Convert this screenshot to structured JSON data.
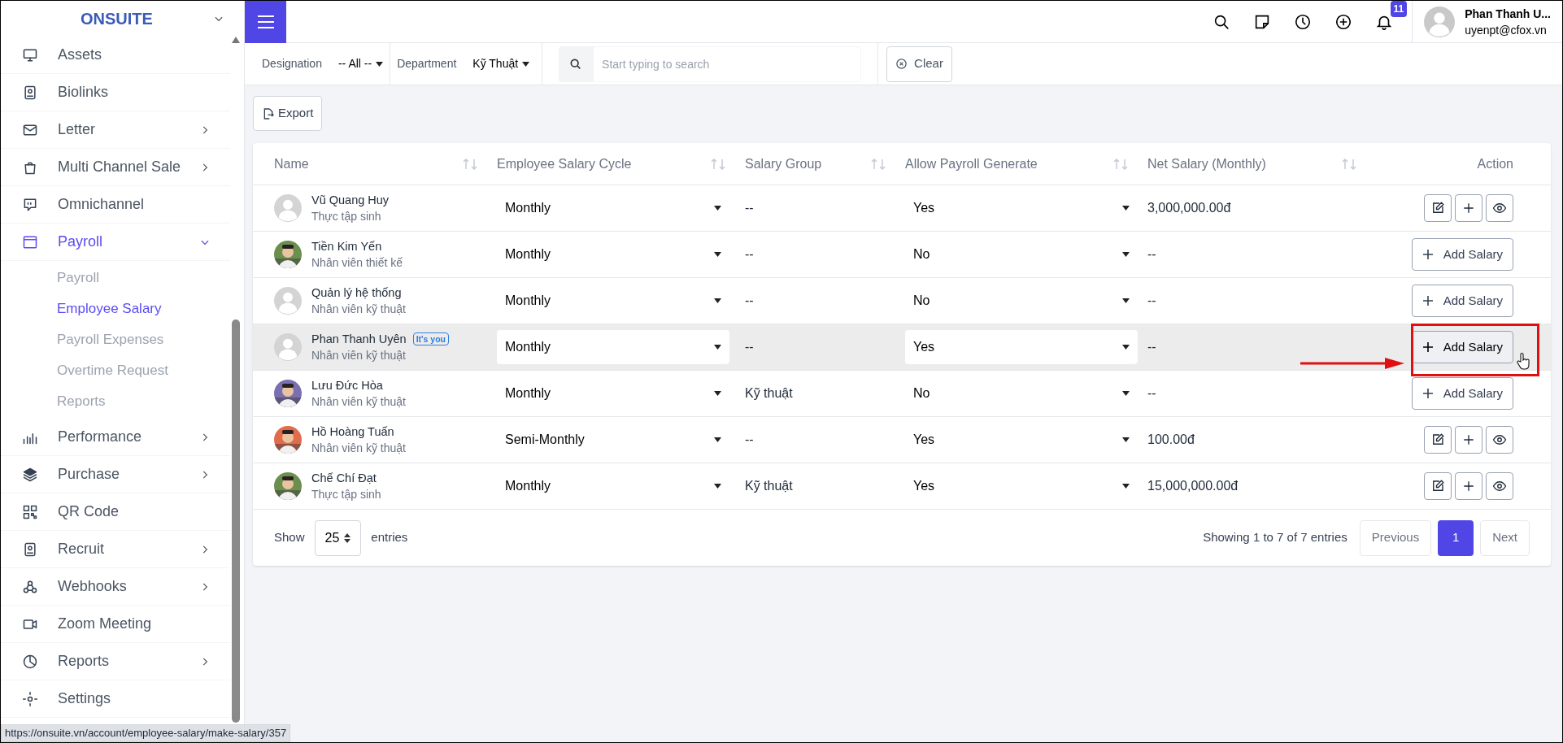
{
  "brand": "ONSUITE",
  "sidebar": {
    "items": [
      {
        "label": "Assets",
        "submenu": false,
        "selected": false
      },
      {
        "label": "Biolinks",
        "submenu": false,
        "selected": false
      },
      {
        "label": "Letter",
        "submenu": true,
        "expanded": false,
        "selected": false
      },
      {
        "label": "Multi Channel Sale",
        "submenu": true,
        "expanded": false,
        "selected": false
      },
      {
        "label": "Omnichannel",
        "submenu": false,
        "selected": false
      },
      {
        "label": "Payroll",
        "submenu": true,
        "expanded": true,
        "selected": true,
        "children": [
          {
            "label": "Payroll",
            "selected": false
          },
          {
            "label": "Employee Salary",
            "selected": true
          },
          {
            "label": "Payroll Expenses",
            "selected": false
          },
          {
            "label": "Overtime Request",
            "selected": false
          },
          {
            "label": "Reports",
            "selected": false
          }
        ]
      },
      {
        "label": "Performance",
        "submenu": true,
        "expanded": false,
        "selected": false
      },
      {
        "label": "Purchase",
        "submenu": true,
        "expanded": false,
        "selected": false
      },
      {
        "label": "QR Code",
        "submenu": false,
        "selected": false
      },
      {
        "label": "Recruit",
        "submenu": true,
        "expanded": false,
        "selected": false
      },
      {
        "label": "Webhooks",
        "submenu": true,
        "expanded": false,
        "selected": false
      },
      {
        "label": "Zoom Meeting",
        "submenu": false,
        "selected": false
      },
      {
        "label": "Reports",
        "submenu": true,
        "expanded": false,
        "selected": false
      },
      {
        "label": "Settings",
        "submenu": false,
        "selected": false
      }
    ]
  },
  "header": {
    "notification_count": "11",
    "user_name": "Phan Thanh U...",
    "user_email": "uyenpt@cfox.vn"
  },
  "filters": {
    "designation_label": "Designation",
    "designation_value": "-- All --",
    "department_label": "Department",
    "department_value": "Kỹ Thuật",
    "search_placeholder": "Start typing to search",
    "clear": "Clear"
  },
  "export": "Export",
  "table": {
    "columns": [
      {
        "label": "Name",
        "sortable": true
      },
      {
        "label": "Employee Salary Cycle",
        "sortable": true
      },
      {
        "label": "Salary Group",
        "sortable": true
      },
      {
        "label": "Allow Payroll Generate",
        "sortable": true
      },
      {
        "label": "Net Salary (Monthly)",
        "sortable": true
      },
      {
        "label": "Action",
        "sortable": false
      }
    ],
    "rows": [
      {
        "name": "Vũ Quang Huy",
        "title": "Thực tập sinh",
        "avatar": {
          "kind": "default"
        },
        "badge": null,
        "cycle": "Monthly",
        "group": "--",
        "allow": "Yes",
        "net": "3,000,000.00đ",
        "action": {
          "kind": "manage"
        },
        "hovered": false,
        "highlighted": false
      },
      {
        "name": "Tiền Kim Yến",
        "title": "Nhân viên thiết kế",
        "badge": null,
        "cycle": "Monthly",
        "group": "--",
        "allow": "No",
        "net": "--",
        "action": {
          "kind": "add",
          "label": "Add Salary"
        },
        "hovered": false,
        "highlighted": false
      },
      {
        "name": "Quản lý hệ thống",
        "title": "Nhân viên kỹ thuật",
        "avatar": {
          "kind": "default"
        },
        "badge": null,
        "cycle": "Monthly",
        "group": "--",
        "allow": "No",
        "net": "--",
        "action": {
          "kind": "add",
          "label": "Add Salary"
        },
        "hovered": false,
        "highlighted": false
      },
      {
        "name": "Phan Thanh Uyên",
        "title": "Nhân viên kỹ thuật",
        "avatar": {
          "kind": "default"
        },
        "badge": "It's you",
        "cycle": "Monthly",
        "group": "--",
        "allow": "Yes",
        "net": "--",
        "action": {
          "kind": "add",
          "label": "Add Salary"
        },
        "hovered": true,
        "highlighted": true
      },
      {
        "name": "Lưu Đức Hòa",
        "title": "Nhân viên kỹ thuật",
        "badge": null,
        "cycle": "Monthly",
        "group": "Kỹ thuật",
        "allow": "No",
        "net": "--",
        "action": {
          "kind": "add",
          "label": "Add Salary"
        },
        "hovered": false,
        "highlighted": false
      },
      {
        "name": "Hồ Hoàng Tuấn",
        "title": "Nhân viên kỹ thuật",
        "badge": null,
        "cycle": "Semi-Monthly",
        "group": "--",
        "allow": "Yes",
        "net": "100.00đ",
        "action": {
          "kind": "manage"
        },
        "hovered": false,
        "highlighted": false
      },
      {
        "name": "Chế Chí Đạt",
        "title": "Thực tập sinh",
        "badge": null,
        "cycle": "Monthly",
        "group": "Kỹ thuật",
        "allow": "Yes",
        "net": "15,000,000.00đ",
        "action": {
          "kind": "manage"
        },
        "hovered": false,
        "highlighted": false
      }
    ]
  },
  "footer": {
    "show": "Show",
    "page_size": "25",
    "entries": "entries",
    "info": "Showing 1 to 7 of 7 entries",
    "previous": "Previous",
    "pages": [
      {
        "label": "1",
        "selected": true
      }
    ],
    "next": "Next"
  },
  "status_url": "https://onsuite.vn/account/employee-salary/make-salary/357"
}
